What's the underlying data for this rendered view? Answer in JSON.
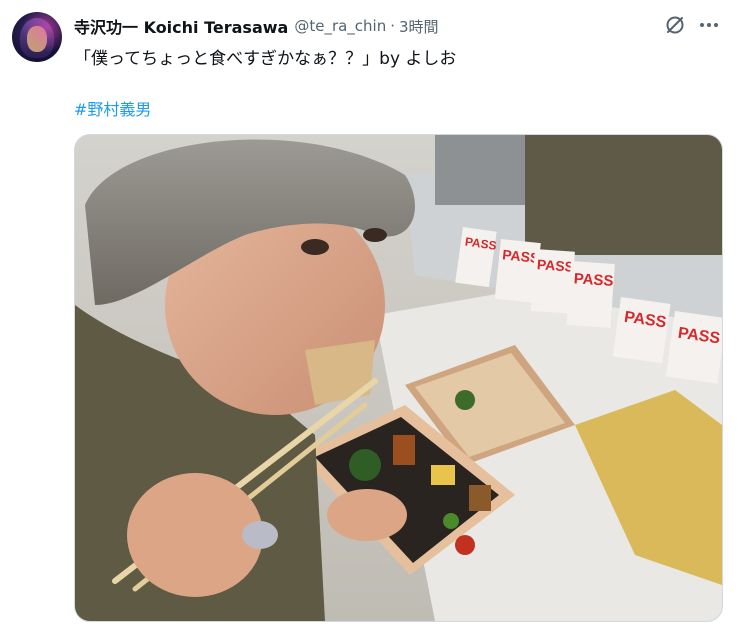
{
  "author": {
    "display_name": "寺沢功一 Koichi Terasawa",
    "handle": "@te_ra_chin",
    "separator": "·",
    "time": "3時間"
  },
  "tweet": {
    "text": "「僕ってちょっと食べすぎかなぁ？？」by よしお",
    "hashtag": "#野村義男"
  },
  "photo": {
    "sign_text": "PASS"
  },
  "icons": {
    "grok": "grok-slash-icon",
    "more": "more-dots-icon"
  },
  "colors": {
    "link": "#1d9bf0",
    "secondary_text": "#536471",
    "pass_red": "#d8282c"
  }
}
